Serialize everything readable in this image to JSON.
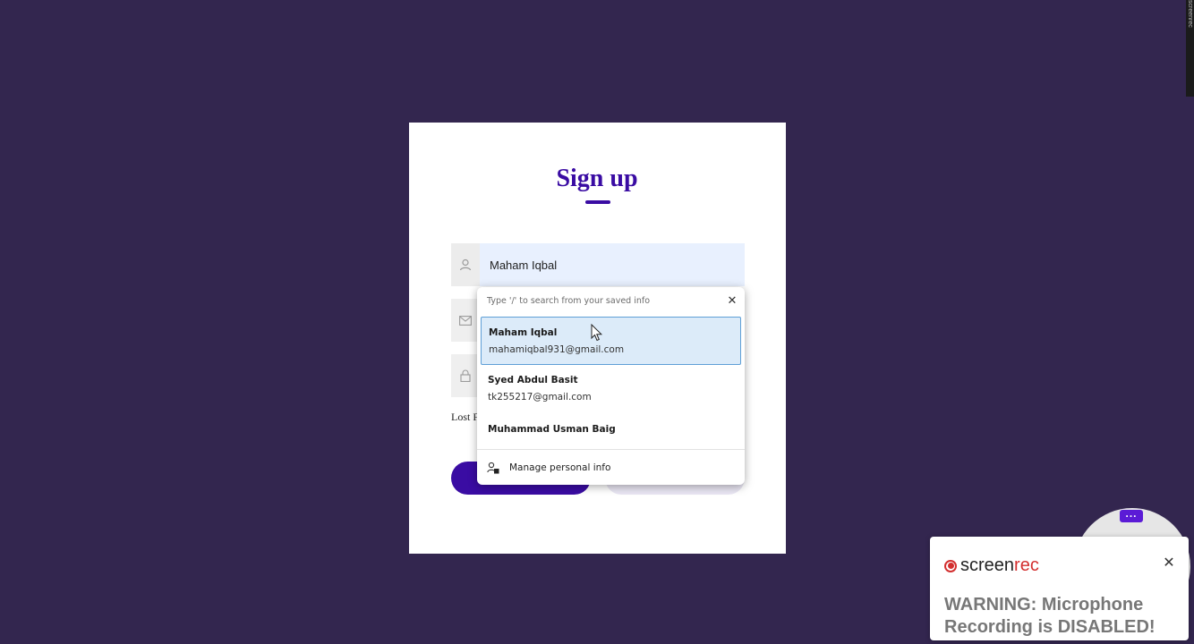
{
  "form": {
    "title": "Sign up",
    "name_value": "Maham Iqbal",
    "lost_text": "Lost F",
    "colors": {
      "accent": "#3a0ca3",
      "background": "#33264f",
      "autofill_bg": "#e8f0fe"
    }
  },
  "autofill": {
    "hint": "Type '/' to search from your saved info",
    "entries": [
      {
        "name": "Maham Iqbal",
        "email": "mahamiqbal931@gmail.com",
        "selected": true
      },
      {
        "name": "Syed Abdul Basit",
        "email": "tk255217@gmail.com",
        "selected": false
      },
      {
        "name": "Muhammad Usman Baig",
        "email": "",
        "selected": false
      }
    ],
    "manage_label": "Manage personal info"
  },
  "icons": {
    "user": "user-icon",
    "mail": "mail-icon",
    "lock": "lock-icon",
    "close": "close-icon",
    "manage": "manage-person-icon",
    "more": "more-icon"
  },
  "overlay": {
    "side_tab_text": "screenrec",
    "more_dots": "...",
    "logo_part1": "screen",
    "logo_part2": "rec",
    "warning": "WARNING: Microphone Recording is DISABLED!"
  }
}
